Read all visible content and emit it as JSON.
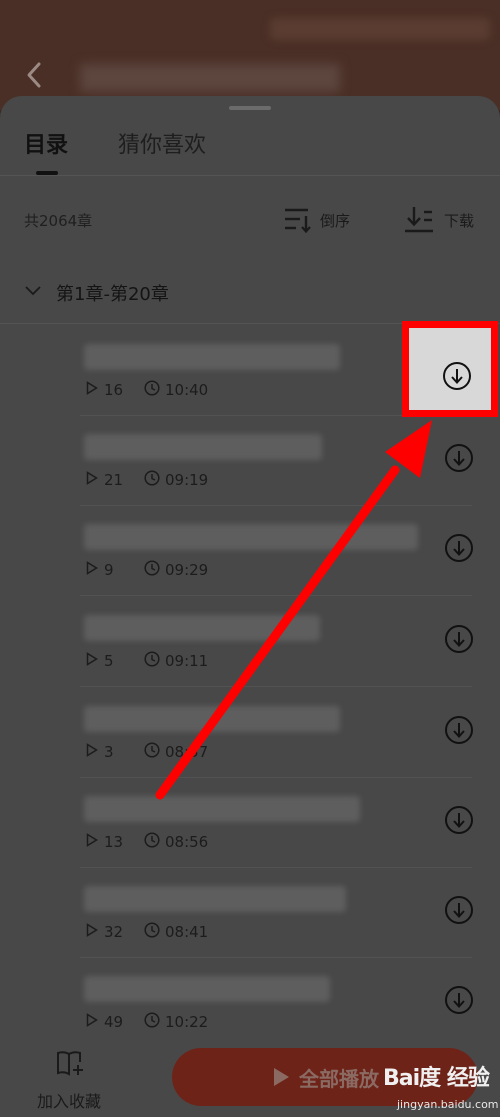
{
  "tabs": {
    "toc": "目录",
    "guess": "猜你喜欢"
  },
  "info": {
    "chapter_count": "共2064章",
    "sort_label": "倒序",
    "download_label": "下载"
  },
  "section": {
    "title": "第1章-第20章"
  },
  "episodes": [
    {
      "plays": "16",
      "duration": "10:40"
    },
    {
      "plays": "21",
      "duration": "09:19"
    },
    {
      "plays": "9",
      "duration": "09:29"
    },
    {
      "plays": "5",
      "duration": "09:11"
    },
    {
      "plays": "3",
      "duration": "08:57"
    },
    {
      "plays": "13",
      "duration": "08:56"
    },
    {
      "plays": "32",
      "duration": "08:41"
    },
    {
      "plays": "49",
      "duration": "10:22"
    }
  ],
  "bottom": {
    "favorite_label": "加入收藏",
    "play_all_label": "全部播放"
  },
  "watermark": {
    "main": "Bai度 经验",
    "sub": "jingyan.baidu.com"
  },
  "colors": {
    "highlight": "#ff0000",
    "play_all": "#6e2318"
  },
  "icons": [
    "back-icon",
    "sort-desc-icon",
    "download-icon",
    "chevron-down-icon",
    "play-count-icon",
    "clock-icon",
    "download-circle-icon",
    "book-add-icon",
    "play-icon"
  ]
}
